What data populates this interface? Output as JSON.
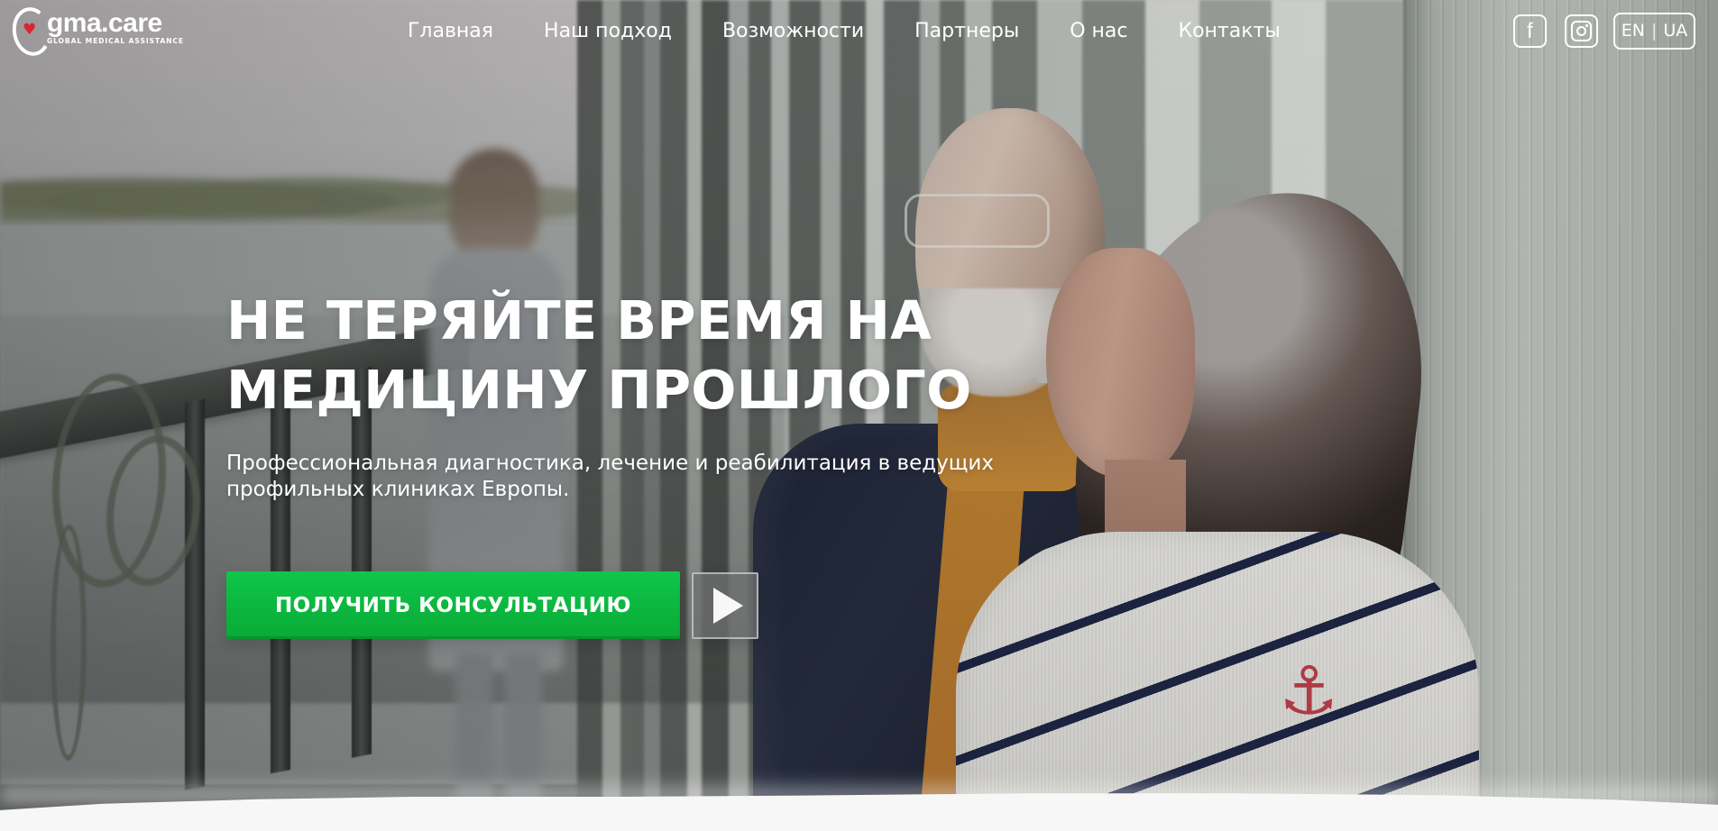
{
  "brand": {
    "name": "gma.care",
    "tagline": "GLOBAL MEDICAL ASSISTANCE",
    "logo_icon": "heart-ring-icon",
    "accent_color": "#d9252f"
  },
  "nav": {
    "items": [
      "Главная",
      "Наш подход",
      "Возможности",
      "Партнеры",
      "О нас",
      "Контакты"
    ]
  },
  "socials": {
    "facebook_label": "f",
    "facebook_icon": "facebook-icon",
    "instagram_icon": "instagram-icon"
  },
  "language": {
    "primary": "EN",
    "secondary": "UA",
    "separator": "|"
  },
  "hero": {
    "title": "НЕ ТЕРЯЙТЕ ВРЕМЯ НА МЕДИЦИНУ ПРОШЛОГО",
    "subtitle": "Профессиональная диагностика, лечение и реабилитация в ведущих профильных клиниках Европы.",
    "cta_label": "ПОЛУЧИТЬ КОНСУЛЬТАЦИЮ",
    "cta_color": "#10c64a",
    "play_icon": "play-icon"
  }
}
